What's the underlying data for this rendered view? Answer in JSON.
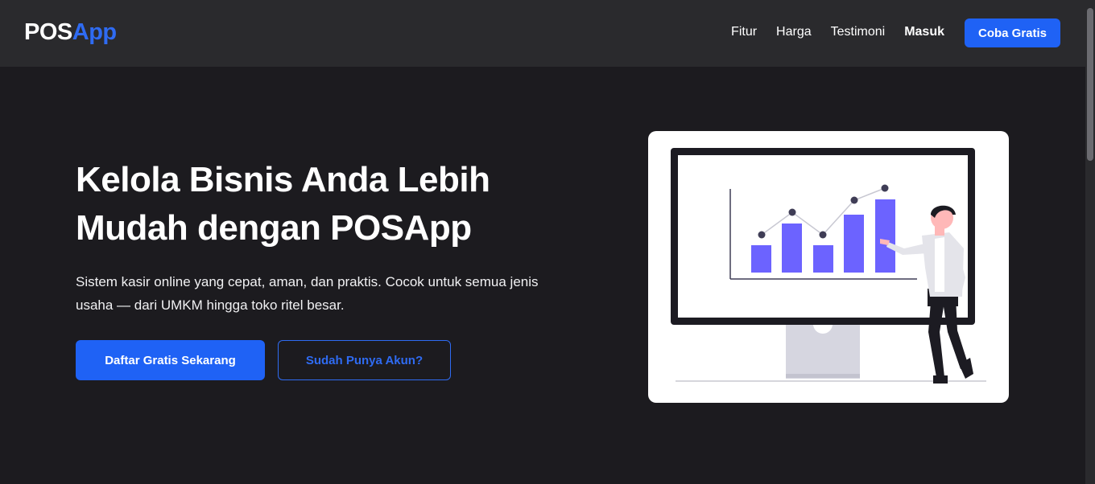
{
  "brand": {
    "pos": "POS",
    "app": "App"
  },
  "nav": {
    "links": [
      "Fitur",
      "Harga",
      "Testimoni"
    ],
    "login": "Masuk",
    "cta": "Coba Gratis"
  },
  "hero": {
    "title": "Kelola Bisnis Anda Lebih Mudah dengan POSApp",
    "description": "Sistem kasir online yang cepat, aman, dan praktis. Cocok untuk semua jenis usaha — dari UMKM hingga toko ritel besar.",
    "primary_button": "Daftar Gratis Sekarang",
    "secondary_button": "Sudah Punya Akun?"
  },
  "illustration": {
    "name": "presentation-illustration",
    "bar_color": "#6c63ff"
  },
  "colors": {
    "accent": "#1f62f5",
    "background": "#1c1b1f",
    "navbar": "#2a2a2d"
  }
}
